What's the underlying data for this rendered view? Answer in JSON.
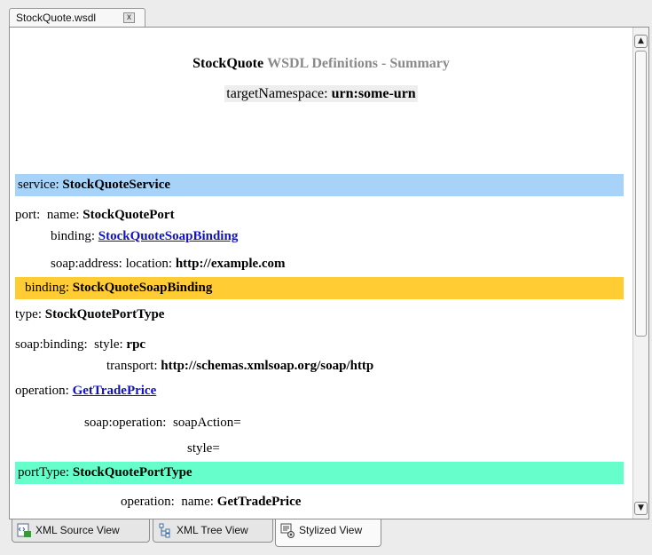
{
  "editor_tab": {
    "title": "StockQuote.wsdl",
    "close": "x"
  },
  "header": {
    "name": "StockQuote",
    "suffix": "WSDL Definitions - Summary",
    "ns_label": "targetNamespace:",
    "ns_value": "urn:some-urn"
  },
  "service": {
    "label": "service:",
    "name": "StockQuoteService",
    "port_label": "port:",
    "name_label": "name:",
    "port_name": "StockQuotePort",
    "binding_label": "binding:",
    "binding_link": "StockQuoteSoapBinding",
    "address_label": "soap:address: location:",
    "address_value": "http://example.com"
  },
  "binding": {
    "label": "binding:",
    "name": "StockQuoteSoapBinding",
    "type_label": "type:",
    "type_value": "StockQuotePortType",
    "soapbinding_label": "soap:binding:",
    "style_label": "style:",
    "style_value": "rpc",
    "transport_label": "transport:",
    "transport_value": "http://schemas.xmlsoap.org/soap/http",
    "operation_label": "operation:",
    "operation_link": "GetTradePrice",
    "soapop_label": "soap:operation:",
    "soapaction_label": "soapAction=",
    "soapstyle_label": "style="
  },
  "porttype": {
    "label": "portType:",
    "name": "StockQuotePortType",
    "op_label": "operation:",
    "op_name_label": "name:",
    "op_name": "GetTradePrice"
  },
  "view_tabs": [
    {
      "label": "XML Source View",
      "icon": "xml-source-icon"
    },
    {
      "label": "XML Tree View",
      "icon": "tree-icon"
    },
    {
      "label": "Stylized View",
      "icon": "stylized-view-icon"
    }
  ],
  "colors": {
    "service_bar": "#a8d3f8",
    "binding_bar": "#ffcc33",
    "porttype_bar": "#66ffcc",
    "link": "#1010cc"
  }
}
